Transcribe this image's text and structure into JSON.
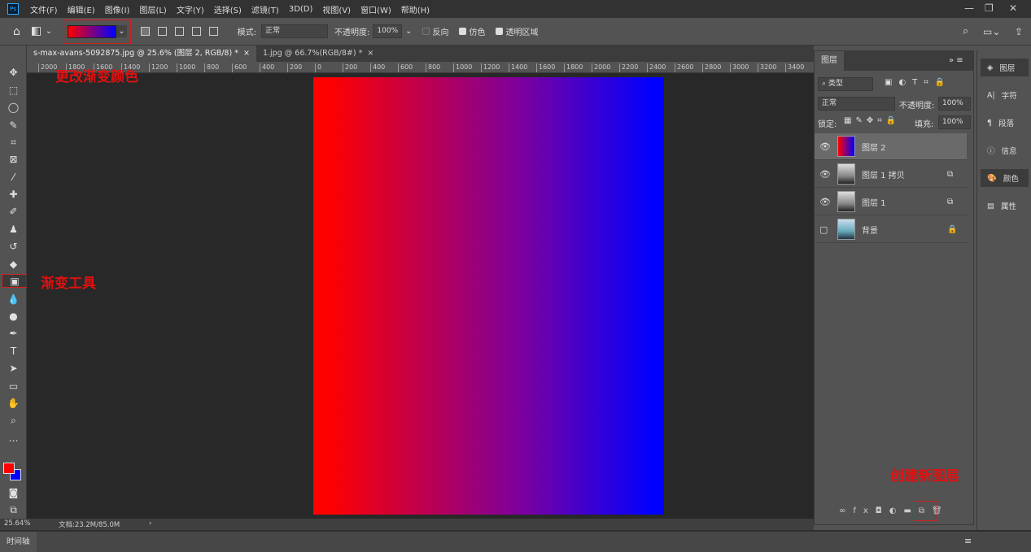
{
  "menubar": {
    "logo": "Ps",
    "items": [
      "文件(F)",
      "编辑(E)",
      "图像(I)",
      "图层(L)",
      "文字(Y)",
      "选择(S)",
      "滤镜(T)",
      "3D(D)",
      "视图(V)",
      "窗口(W)",
      "帮助(H)"
    ],
    "min": "—",
    "restore": "❐",
    "close": "✕"
  },
  "options": {
    "mode_label": "模式:",
    "mode_value": "正常",
    "opacity_label": "不透明度:",
    "opacity_value": "100%",
    "reverse": "反向",
    "dither": "仿色",
    "transparency": "透明区域",
    "gradient_colors": [
      "#ff0000",
      "#0000ff"
    ]
  },
  "tabs": [
    {
      "label": "s-max-avans-5092875.jpg @ 25.6% (图层 2, RGB/8) *",
      "close": "×"
    },
    {
      "label": "1.jpg @ 66.7%(RGB/8#) *",
      "close": "×"
    }
  ],
  "ruler": [
    "2000",
    "1800",
    "1600",
    "1400",
    "1200",
    "1000",
    "800",
    "600",
    "400",
    "200",
    "0",
    "200",
    "400",
    "600",
    "800",
    "1000",
    "1200",
    "1400",
    "1600",
    "1800",
    "2000",
    "2200",
    "2400",
    "2600",
    "2800",
    "3000",
    "3200",
    "3400"
  ],
  "annotations": {
    "gradient_color": "更改渐变颜色",
    "gradient_tool": "渐变工具",
    "new_layer": "创建新图层"
  },
  "colors": {
    "foreground": "#ff0000",
    "background": "#0000ff",
    "annotation": "#e01010"
  },
  "status": {
    "zoom": "25.64%",
    "doc": "文档:23.2M/85.0M",
    "arrow": "›"
  },
  "timeline": {
    "label": "时间轴"
  },
  "layers_panel": {
    "tab": "图层",
    "filter": "类型",
    "blend": "正常",
    "opacity_label": "不透明度:",
    "opacity": "100%",
    "lock_label": "锁定:",
    "fill_label": "填充:",
    "fill": "100%",
    "layers": [
      {
        "name": "图层 2",
        "visible": true,
        "selected": true
      },
      {
        "name": "图层 1 拷贝",
        "visible": true
      },
      {
        "name": "图层 1",
        "visible": true
      },
      {
        "name": "背景",
        "visible": false,
        "locked": true
      }
    ]
  },
  "right_strip": [
    "图层",
    "字符",
    "段落",
    "信息",
    "颜色",
    "属性"
  ]
}
